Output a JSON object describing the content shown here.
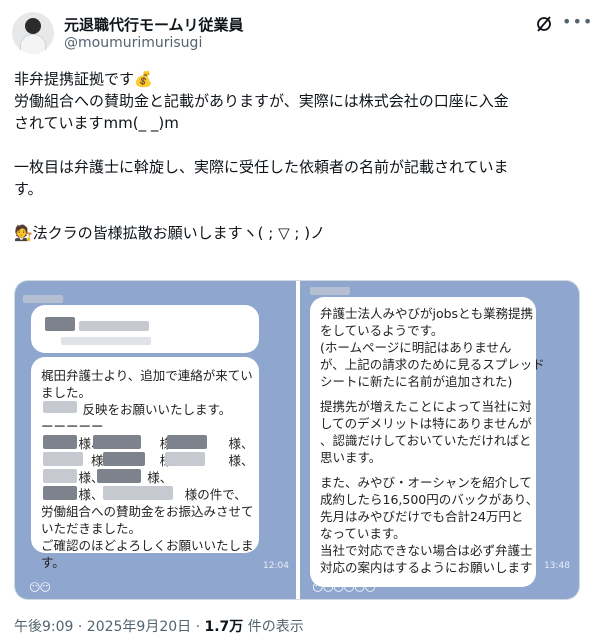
{
  "author": {
    "display_name": "元退職代行モームリ従業員",
    "handle": "@moumurimurisugi"
  },
  "header_icons": [
    "grok-icon",
    "more-icon"
  ],
  "tweet": {
    "lines": [
      "非弁提携証拠です💰",
      "労働組合への賛助金と記載がありますが、実際には株式会社の口座に入金",
      "されていますmm(_ _)m",
      "",
      "一枚目は弁護士に斡旋し、実際に受任した依頼者の名前が記載されていま",
      "す。",
      "",
      "🧑‍⚖️法クラの皆様拡散お願いしますヽ( ; ▽ ; )ノ"
    ]
  },
  "media": {
    "left_message": {
      "lines": [
        "梶田弁護士より、追加で連絡が来てい",
        "ました。",
        "　　　 反映をお願いいたします。",
        "ーーーーー",
        "　　　様、　　　　　様、　　　　様、",
        "　　　　様、　　　　様、　　　　様、",
        "　　　様、　　　　様、",
        "　　　様、　　　　　　　様の件で、",
        "労働組合への賛助金をお振込みさせて",
        "いただきました。",
        "ご確認のほどよろしくお願いいたしま",
        "す。"
      ],
      "time": "12:04",
      "stickers": "😶😶"
    },
    "right_message": {
      "lines": [
        "弁護士法人みやびがjobsとも業務提携",
        "をしているようです。",
        "(ホームページに明記はありません",
        "が、上記の請求のために見るスプレッド",
        "シートに新たに名前が追加された)",
        "",
        "提携先が増えたことによって当社に対",
        "してのデメリットは特にありませんが",
        "、認識だけしておいていただければと",
        "思います。",
        "",
        "また、みやび・オーシャンを紹介して",
        "成約したら16,500円のバックがあり、",
        "先月はみやびだけでも合計24万円と",
        "なっています。",
        "当社で対応できない場合は必ず弁護士",
        "対応の案内はするようにお願いします"
      ],
      "time": "13:48",
      "stickers": "😶😶😶😶😶😶"
    }
  },
  "meta": {
    "time_date": "午後9:09 · 2025年9月20日 · ",
    "views_count": "1.7万",
    "views_label": " 件の表示"
  },
  "colors": {
    "line_chat_bg": "#8fa6cf",
    "text_primary": "#0f1419",
    "text_secondary": "#536471"
  }
}
